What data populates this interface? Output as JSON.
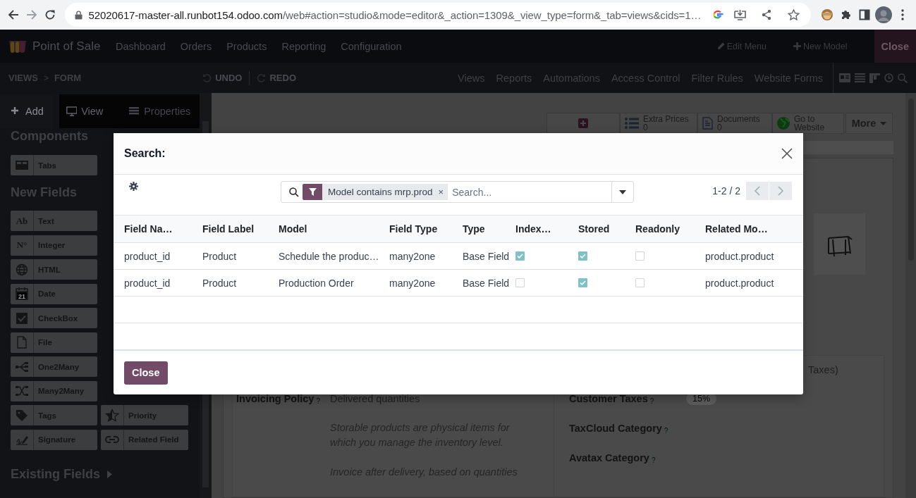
{
  "browser": {
    "url_host": "52020617-master-all.runbot154.odoo.com",
    "url_path": "/web#action=studio&mode=editor&_action=1309&_view_type=form&_tab=views&cids=1…"
  },
  "navbar": {
    "app_name": "Point of Sale",
    "menus": [
      "Dashboard",
      "Orders",
      "Products",
      "Reporting",
      "Configuration"
    ],
    "edit_menu": "Edit Menu",
    "new_model": "New Model",
    "close": "Close"
  },
  "studio_bar": {
    "breadcrumb": [
      "VIEWS",
      "FORM"
    ],
    "separator": ">",
    "undo": "UNDO",
    "redo": "REDO",
    "tabs": [
      "Views",
      "Reports",
      "Automations",
      "Access Control",
      "Filter Rules",
      "Website Forms"
    ]
  },
  "sidebar": {
    "tabs": [
      {
        "label": "Add",
        "kind": "add",
        "selected": true,
        "disabled": false
      },
      {
        "label": "View",
        "kind": "view",
        "selected": false,
        "disabled": false
      },
      {
        "label": "Properties",
        "kind": "properties",
        "selected": false,
        "disabled": true
      }
    ],
    "components_title": "Components",
    "components": [
      {
        "label": "Tabs",
        "kind": "tabs"
      }
    ],
    "new_fields_title": "New Fields",
    "new_fields": [
      {
        "label": "Text",
        "kind": "text",
        "icon_text": "Ab"
      },
      {
        "label": "Integer",
        "kind": "integer",
        "icon_text": "N°"
      },
      {
        "label": "HTML",
        "kind": "html"
      },
      {
        "label": "Date",
        "kind": "date",
        "icon_text": "21"
      },
      {
        "label": "CheckBox",
        "kind": "checkbox"
      },
      {
        "label": "File",
        "kind": "file"
      },
      {
        "label": "One2Many",
        "kind": "one2many"
      },
      {
        "label": "Many2Many",
        "kind": "many2many"
      },
      {
        "label": "Tags",
        "kind": "tags"
      },
      {
        "label": "Signature",
        "kind": "signature"
      }
    ],
    "new_fields_right": [
      {
        "label": "Priority",
        "kind": "priority"
      },
      {
        "label": "Related Field",
        "kind": "related"
      }
    ],
    "existing_fields": "Existing Fields"
  },
  "form": {
    "button_box": [
      {
        "kind": "add"
      },
      {
        "kind": "list",
        "label": "Extra Prices",
        "count": "0"
      },
      {
        "kind": "document",
        "label": "Documents",
        "count": "0"
      },
      {
        "kind": "globe",
        "label": "Go to Website"
      },
      {
        "kind": "more",
        "label": "More"
      }
    ],
    "left_fields": [
      {
        "label": "Invoicing Policy",
        "tooltip": "?",
        "value": "Delivered quantities"
      }
    ],
    "help_texts": [
      "Storable products are physical items for which you manage the inventory level.",
      "Invoice after delivery, based on quantities"
    ],
    "right_fields": [
      {
        "value": "Taxes)"
      },
      {
        "label": "Customer Taxes",
        "tooltip": "?",
        "tag": "15%"
      },
      {
        "label": "TaxCloud Category",
        "tooltip": "?"
      },
      {
        "label": "Avatax Category",
        "tooltip": "?"
      }
    ]
  },
  "modal": {
    "title": "Search:",
    "filter": "Model contains mrp.prod",
    "filter_remove": "×",
    "search_placeholder": "Search...",
    "pager": "1-2 / 2",
    "columns": [
      "Field Na…",
      "Field Label",
      "Model",
      "Field Type",
      "Type",
      "Index…",
      "Stored",
      "Readonly",
      "Related Mo…"
    ],
    "rows": [
      {
        "cells": [
          "product_id",
          "Product",
          "Schedule the produc…",
          "many2one",
          "Base Field"
        ],
        "indexed": true,
        "stored": true,
        "readonly": false,
        "related": "product.product"
      },
      {
        "cells": [
          "product_id",
          "Product",
          "Production Order",
          "many2one",
          "Base Field"
        ],
        "indexed": false,
        "stored": true,
        "readonly": false,
        "related": "product.product"
      }
    ],
    "close": "Close"
  }
}
